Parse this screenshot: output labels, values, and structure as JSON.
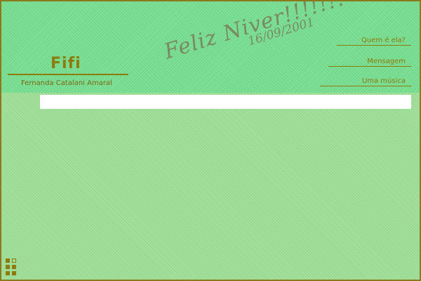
{
  "header": {
    "brand_name": "Fifi",
    "brand_subtitle": "Fernanda Catalani Amaral",
    "greeting_title": "Feliz Niver!!!!!!!",
    "greeting_date": "16/09/2001"
  },
  "nav": {
    "items": [
      {
        "label": "Quem é ela?"
      },
      {
        "label": "Mensagem"
      },
      {
        "label": "Uma música"
      }
    ]
  },
  "colors": {
    "accent": "#8d7b0d",
    "header_bg": "#80e39a",
    "page_bg": "#a2e2a0",
    "content_bar": "#ffffff"
  },
  "icons": {
    "corner": "grid-squares-icon"
  }
}
